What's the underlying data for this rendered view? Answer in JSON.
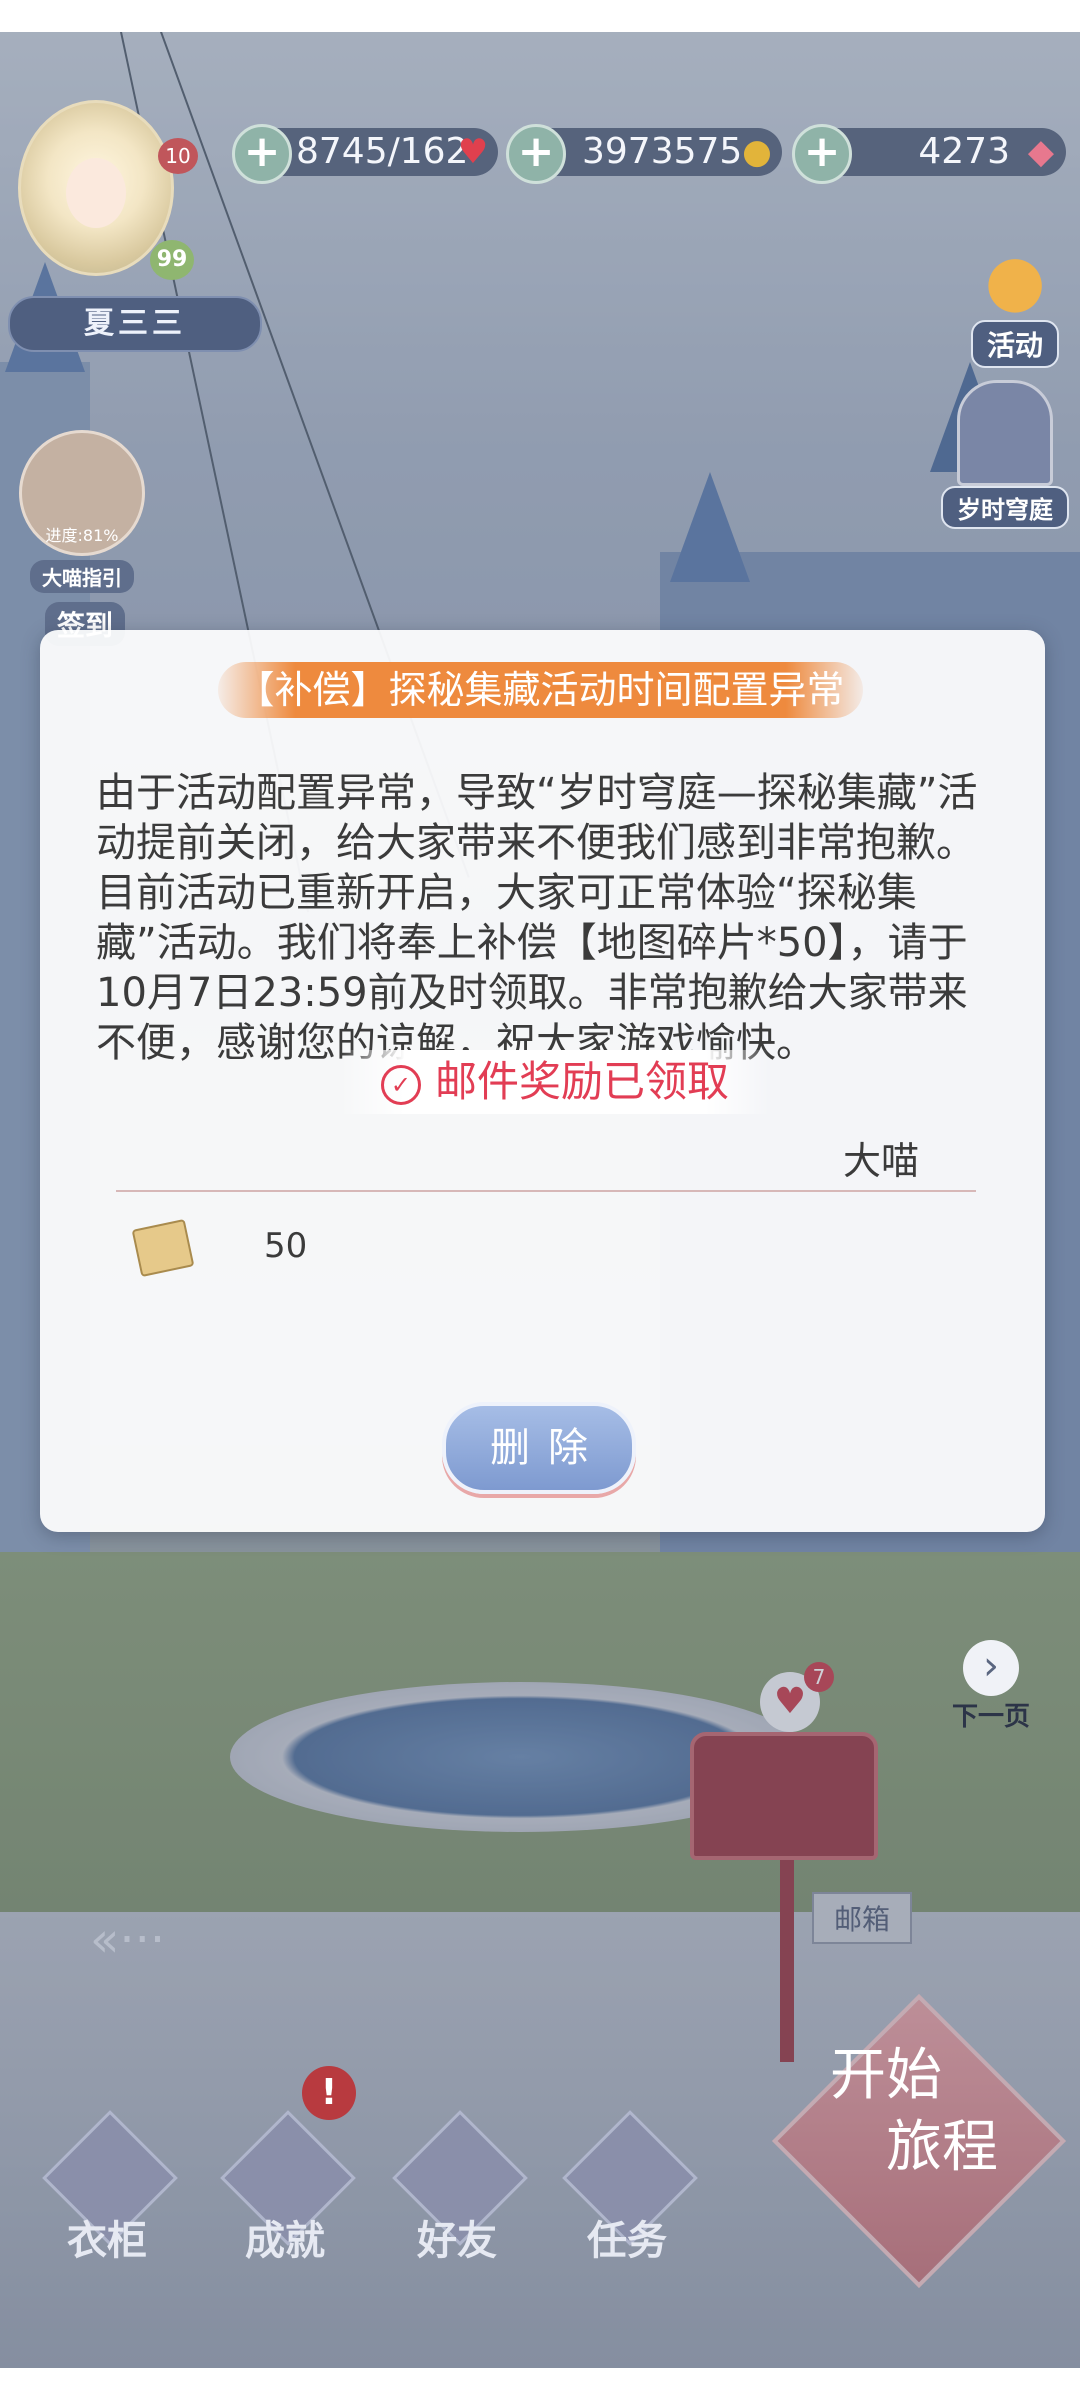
{
  "player": {
    "name": "夏三三",
    "level": "10",
    "vip": "99"
  },
  "resources": {
    "stamina": "8745/162",
    "gold": "3973575",
    "diamonds": "4273"
  },
  "left_menu": {
    "guide_progress": "进度:81%",
    "guide_label": "大喵指引",
    "checkin_label": "签到"
  },
  "right_menu": {
    "activity_label": "活动",
    "courtyard_label": "岁时穹庭",
    "next_page_label": "下一页"
  },
  "dialog": {
    "title": "【补偿】探秘集藏活动时间配置异常",
    "body": "由于活动配置异常，导致“岁时穹庭—探秘集藏”活动提前关闭，给大家带来不便我们感到非常抱歉。目前活动已重新开启，大家可正常体验“探秘集藏”活动。我们将奉上补偿【地图碎片*50】，请于10月7日23:59前及时领取。非常抱歉给大家带来不便，感谢您的谅解，祝大家游戏愉快。",
    "sender": "大喵",
    "claimed_status": "邮件奖励已领取",
    "reward_quantity": "50",
    "delete_label": "删除"
  },
  "mail": {
    "badge_count": "7",
    "sign_label": "邮箱"
  },
  "bottom_nav": {
    "wardrobe": "衣柜",
    "achievements": "成就",
    "friends": "好友",
    "tasks": "任务",
    "start_line1": "开始",
    "start_line2": "旅程"
  },
  "icons": {
    "stamina": "heart-icon",
    "gold": "coin-icon",
    "diamonds": "gem-icon"
  }
}
